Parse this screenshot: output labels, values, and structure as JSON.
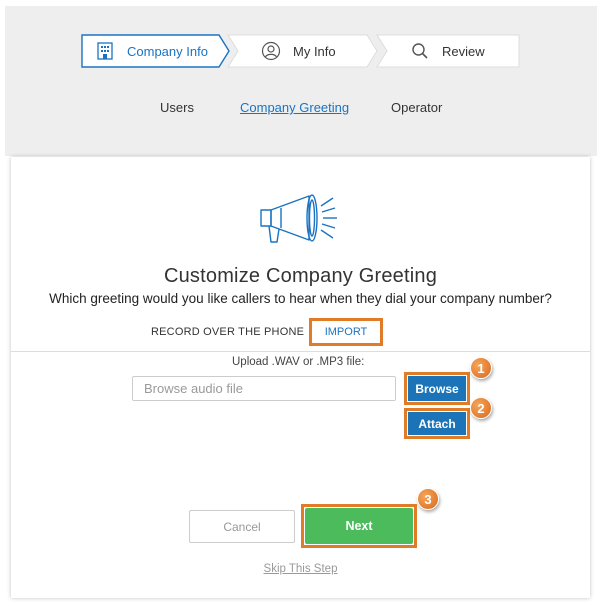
{
  "stepper": {
    "steps": [
      {
        "label": "Company Info",
        "icon": "building-icon",
        "active": true
      },
      {
        "label": "My Info",
        "icon": "user-icon",
        "active": false
      },
      {
        "label": "Review",
        "icon": "search-icon",
        "active": false
      }
    ]
  },
  "subnav": {
    "users": "Users",
    "company_greeting": "Company Greeting",
    "operator": "Operator"
  },
  "card": {
    "icon": "megaphone-icon",
    "title": "Customize Company Greeting",
    "question": "Which greeting would you like callers to hear when they dial your company number?",
    "tabs": {
      "record": "RECORD OVER THE PHONE",
      "import": "IMPORT"
    },
    "upload_label": "Upload .WAV or .MP3 file:",
    "browse_placeholder": "Browse audio file",
    "browse_button": "Browse",
    "attach_button": "Attach",
    "cancel_button": "Cancel",
    "next_button": "Next",
    "skip_link": "Skip This Step"
  },
  "callouts": [
    "1",
    "2",
    "3"
  ],
  "colors": {
    "accent_blue": "#1a73c2",
    "button_blue": "#1c74b8",
    "next_green": "#4cbb5c",
    "highlight_orange": "#e07c28",
    "top_background": "#eeeeef"
  }
}
